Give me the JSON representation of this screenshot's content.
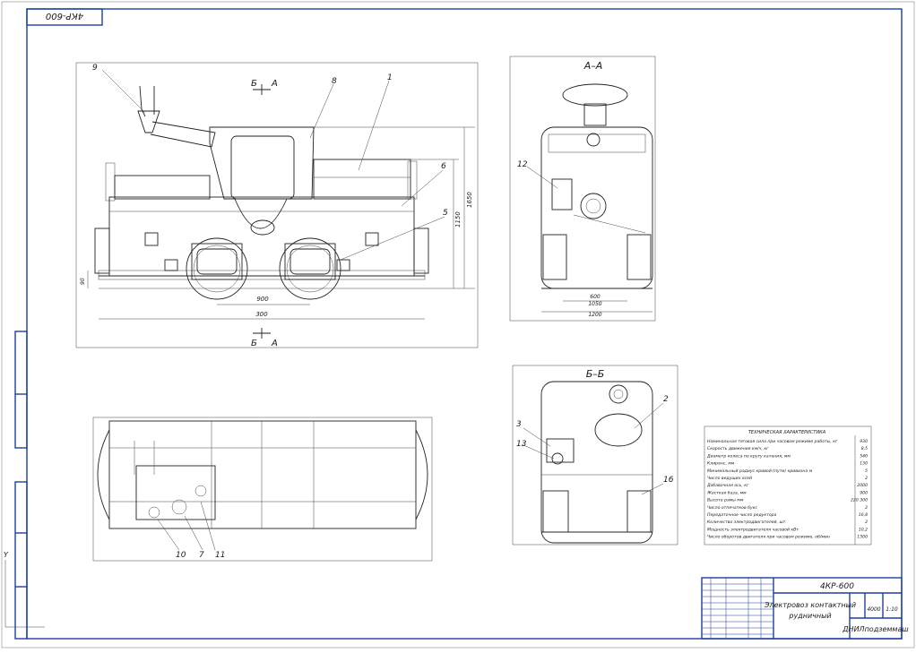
{
  "stamp_top": "4КР-600",
  "views": {
    "side": {
      "section_marks": [
        "Б",
        "А",
        "Б",
        "А"
      ],
      "callouts": [
        "9",
        "8",
        "1",
        "6",
        "5"
      ],
      "dims": [
        "900",
        "1650",
        "1150",
        "300",
        "90"
      ]
    },
    "section_aa": {
      "title": "А–А",
      "callouts": [
        "12"
      ],
      "dims": [
        "600",
        "1050",
        "1200"
      ]
    },
    "section_bb": {
      "title": "Б–Б",
      "callouts": [
        "2",
        "3",
        "13",
        "16"
      ]
    },
    "plan": {
      "callouts": [
        "10",
        "7",
        "11"
      ]
    }
  },
  "tech": {
    "title": "ТЕХНИЧЕСКАЯ ХАРАКТЕРИСТИКА",
    "rows": [
      {
        "label": "Номинальная тяговая сила при часовом режиме работы, кг",
        "value": "930"
      },
      {
        "label": "Скорость движения км/ч, кг",
        "value": "8,5"
      },
      {
        "label": "Диаметр колеса по кругу катания, мм",
        "value": "540"
      },
      {
        "label": "Клиренс, мм",
        "value": "130"
      },
      {
        "label": "Минимальный радиус кривой (пути) кривизна м",
        "value": "5"
      },
      {
        "label": "Число ведущих осей",
        "value": "2"
      },
      {
        "label": "Добавочная ось, кг",
        "value": "2000"
      },
      {
        "label": "Жесткая база, мм",
        "value": "900"
      },
      {
        "label": "Высота рамы мм",
        "value": "220 300"
      },
      {
        "label": "Число отпечатков букс",
        "value": "2"
      },
      {
        "label": "Передаточное число редуктора",
        "value": "16,8"
      },
      {
        "label": "Количество электродвигателей, шт.",
        "value": "2"
      },
      {
        "label": "Мощность электродвигателя часовой кВт",
        "value": "10,2"
      },
      {
        "label": "Число оборотов двигателя при часовом режиме, об/мин",
        "value": "1500"
      }
    ]
  },
  "title_block": {
    "code": "4КР-600",
    "name_line1": "Электровоз контактный",
    "name_line2": "рудничный",
    "mass": "4000",
    "scale": "1:10",
    "org": "ДНИЛподземмаш"
  },
  "colors": {
    "frame": "#1f3f9f",
    "lines": "#222222"
  }
}
